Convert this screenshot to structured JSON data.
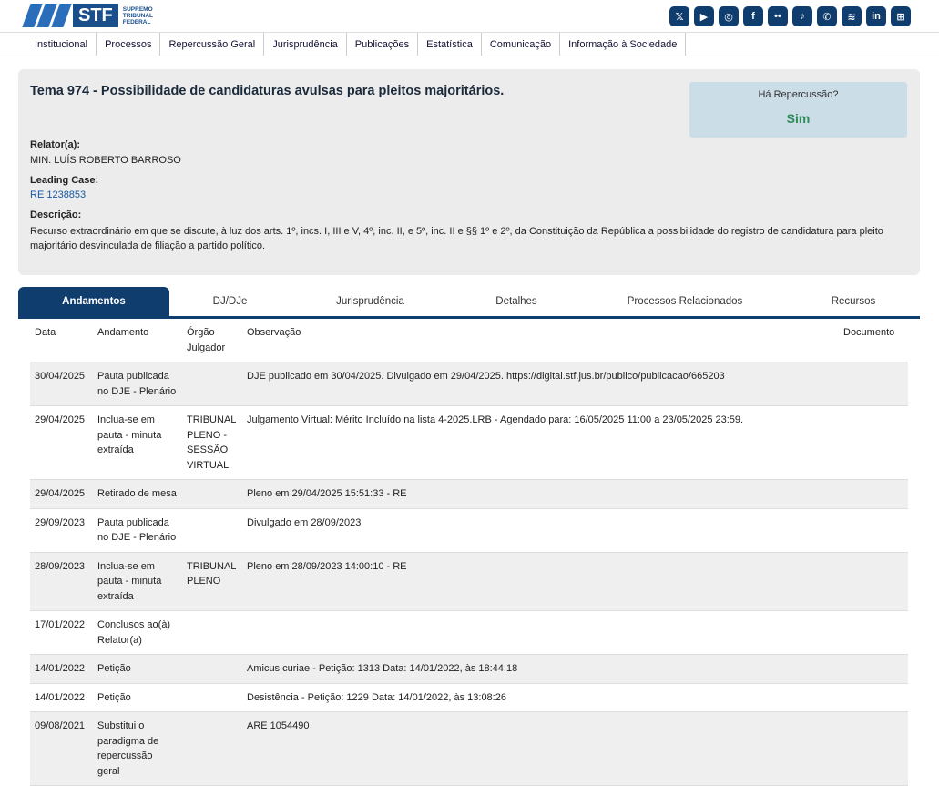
{
  "brand": {
    "abbr": "STF",
    "name": "SUPREMO TRIBUNAL FEDERAL"
  },
  "social": [
    {
      "icon": "x-icon",
      "glyph": "𝕏"
    },
    {
      "icon": "youtube-icon",
      "glyph": "▶"
    },
    {
      "icon": "instagram-icon",
      "glyph": "◎"
    },
    {
      "icon": "facebook-icon",
      "glyph": "f"
    },
    {
      "icon": "flickr-icon",
      "glyph": "••"
    },
    {
      "icon": "tiktok-icon",
      "glyph": "♪"
    },
    {
      "icon": "whatsapp-icon",
      "glyph": "✆"
    },
    {
      "icon": "spotify-icon",
      "glyph": "≋"
    },
    {
      "icon": "linkedin-icon",
      "glyph": "in"
    },
    {
      "icon": "apps-icon",
      "glyph": "⊞"
    }
  ],
  "nav": [
    "Institucional",
    "Processos",
    "Repercussão Geral",
    "Jurisprudência",
    "Publicações",
    "Estatística",
    "Comunicação",
    "Informação à Sociedade"
  ],
  "tema": {
    "title": "Tema 974 - Possibilidade de candidaturas avulsas para pleitos majoritários.",
    "rep_question": "Há Repercussão?",
    "rep_answer": "Sim",
    "relator_label": "Relator(a):",
    "relator": "MIN. LUÍS ROBERTO BARROSO",
    "leading_label": "Leading Case:",
    "leading": "RE 1238853",
    "desc_label": "Descrição:",
    "desc": "Recurso extraordinário em que se discute, à luz dos arts. 1º, incs. I, III e V, 4º, inc. II, e 5º, inc. II e §§ 1º e 2º, da Constituição da República a possibilidade do registro de candidatura para pleito majoritário desvinculada de filiação a partido político."
  },
  "tabs": [
    "Andamentos",
    "DJ/DJe",
    "Jurisprudência",
    "Detalhes",
    "Processos Relacionados",
    "Recursos"
  ],
  "table": {
    "headers": [
      "Data",
      "Andamento",
      "Órgão Julgador",
      "Observação",
      "Documento"
    ],
    "rows": [
      [
        "30/04/2025",
        "Pauta publicada no DJE - Plenário",
        "",
        "DJE publicado em 30/04/2025. Divulgado em 29/04/2025. https://digital.stf.jus.br/publico/publicacao/665203",
        ""
      ],
      [
        "29/04/2025",
        "Inclua-se em pauta - minuta extraída",
        "TRIBUNAL PLENO - SESSÃO VIRTUAL",
        "Julgamento Virtual: Mérito Incluído na lista 4-2025.LRB - Agendado para: 16/05/2025 11:00 a 23/05/2025 23:59.",
        ""
      ],
      [
        "29/04/2025",
        "Retirado de mesa",
        "",
        "Pleno em 29/04/2025 15:51:33 - RE",
        ""
      ],
      [
        "29/09/2023",
        "Pauta publicada no DJE - Plenário",
        "",
        "Divulgado em 28/09/2023",
        ""
      ],
      [
        "28/09/2023",
        "Inclua-se em pauta - minuta extraída",
        "TRIBUNAL PLENO",
        "Pleno em 28/09/2023 14:00:10 - RE",
        ""
      ],
      [
        "17/01/2022",
        "Conclusos ao(à) Relator(a)",
        "",
        "",
        ""
      ],
      [
        "14/01/2022",
        "Petição",
        "",
        "Amicus curiae - Petição: 1313 Data: 14/01/2022, às 18:44:18",
        ""
      ],
      [
        "14/01/2022",
        "Petição",
        "",
        "Desistência - Petição: 1229 Data: 14/01/2022, às 13:08:26",
        ""
      ],
      [
        "09/08/2021",
        "Substitui o paradigma de repercussão geral",
        "",
        "ARE 1054490",
        ""
      ]
    ]
  }
}
